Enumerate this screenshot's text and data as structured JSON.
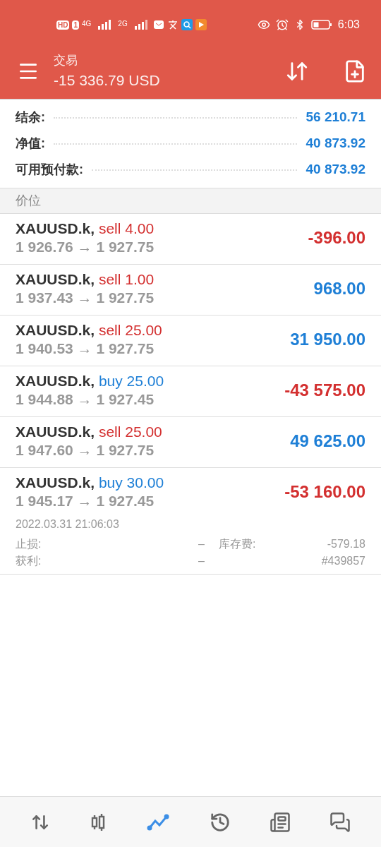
{
  "status_bar": {
    "time": "6:03",
    "badge": "HD",
    "sim": "1",
    "networks": [
      "4G",
      "2G"
    ]
  },
  "header": {
    "title": "交易",
    "subtitle": "-15 336.79 USD"
  },
  "summary": [
    {
      "label": "结余:",
      "value": "56 210.71"
    },
    {
      "label": "净值:",
      "value": "40 873.92"
    },
    {
      "label": "可用预付款:",
      "value": "40 873.92"
    }
  ],
  "section_title": "价位",
  "positions": [
    {
      "symbol": "XAUUSD.k,",
      "kind": "sell",
      "side": "sell",
      "volume": "4.00",
      "prices": "1 926.76 → 1 927.75",
      "profit": "-396.00",
      "loss": true,
      "expanded": false
    },
    {
      "symbol": "XAUUSD.k,",
      "kind": "sell",
      "side": "sell",
      "volume": "1.00",
      "prices": "1 937.43 → 1 927.75",
      "profit": "968.00",
      "loss": false,
      "expanded": false
    },
    {
      "symbol": "XAUUSD.k,",
      "kind": "sell",
      "side": "sell",
      "volume": "25.00",
      "prices": "1 940.53 → 1 927.75",
      "profit": "31 950.00",
      "loss": false,
      "expanded": false
    },
    {
      "symbol": "XAUUSD.k,",
      "kind": "buy",
      "side": "buy",
      "volume": "25.00",
      "prices": "1 944.88 → 1 927.45",
      "profit": "-43 575.00",
      "loss": true,
      "expanded": false
    },
    {
      "symbol": "XAUUSD.k,",
      "kind": "sell",
      "side": "sell",
      "volume": "25.00",
      "prices": "1 947.60 → 1 927.75",
      "profit": "49 625.00",
      "loss": false,
      "expanded": false
    },
    {
      "symbol": "XAUUSD.k,",
      "kind": "buy",
      "side": "buy",
      "volume": "30.00",
      "prices": "1 945.17 → 1 927.45",
      "profit": "-53 160.00",
      "loss": true,
      "expanded": true,
      "details": {
        "time": "2022.03.31 21:06:03",
        "stop_loss_label": "止损:",
        "stop_loss": "–",
        "swap_label": "库存费:",
        "swap": "-579.18",
        "take_profit_label": "获利:",
        "take_profit": "–",
        "ticket": "#439857"
      }
    }
  ],
  "nav": [
    {
      "kind": "trade",
      "selected": false
    },
    {
      "kind": "quotes",
      "selected": false
    },
    {
      "kind": "chart",
      "selected": true
    },
    {
      "kind": "history",
      "selected": false
    },
    {
      "kind": "news",
      "selected": false
    },
    {
      "kind": "chat",
      "selected": false
    }
  ]
}
